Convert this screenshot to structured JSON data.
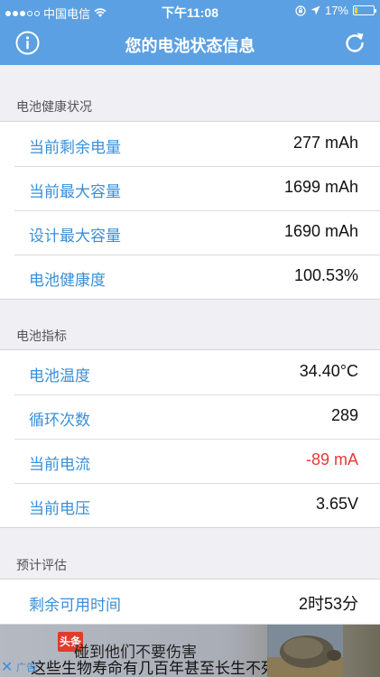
{
  "status_bar": {
    "carrier": "中国电信",
    "time": "下午11:08",
    "battery_percent": "17%",
    "battery_level": 0.17
  },
  "nav": {
    "title": "您的电池状态信息"
  },
  "sections": [
    {
      "header": "电池健康状况",
      "rows": [
        {
          "label": "当前剩余电量",
          "value": "277 mAh"
        },
        {
          "label": "当前最大容量",
          "value": "1699 mAh"
        },
        {
          "label": "设计最大容量",
          "value": "1690 mAh"
        },
        {
          "label": "电池健康度",
          "value": "100.53%"
        }
      ]
    },
    {
      "header": "电池指标",
      "rows": [
        {
          "label": "电池温度",
          "value": "34.40°C"
        },
        {
          "label": "循环次数",
          "value": "289"
        },
        {
          "label": "当前电流",
          "value": "-89 mA"
        },
        {
          "label": "当前电压",
          "value": "3.65V"
        }
      ]
    },
    {
      "header": "预计评估",
      "rows": [
        {
          "label": "剩余可用时间",
          "value": "2时53分"
        }
      ]
    }
  ],
  "ad": {
    "tag": "广告",
    "logo": "头条",
    "line1": "碰到他们不要伤害",
    "line2": "这些生物寿命有几百年甚至长生不死"
  },
  "colors": {
    "accent": "#5ba0e2",
    "label": "#3a8fd8",
    "negative": "#e53935"
  }
}
